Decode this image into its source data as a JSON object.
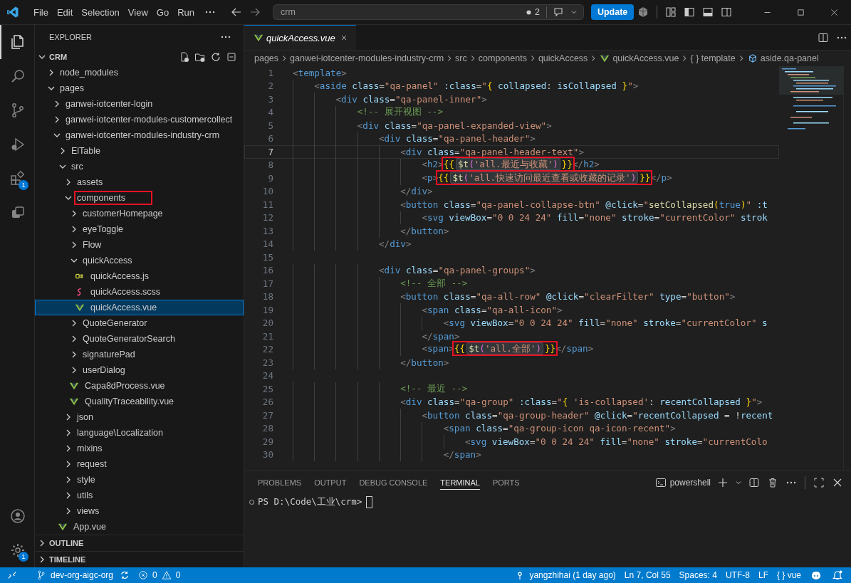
{
  "title_bar": {
    "menu": [
      "File",
      "Edit",
      "Selection",
      "View",
      "Go",
      "Run"
    ],
    "command_center": {
      "label": "crm"
    },
    "changes": {
      "count": "2"
    },
    "update_button": "Update"
  },
  "activity_bar": {
    "items": [
      {
        "kind": "explorer",
        "selected": true
      },
      {
        "kind": "search",
        "selected": false
      },
      {
        "kind": "source-control",
        "selected": false
      },
      {
        "kind": "run-debug",
        "selected": false
      },
      {
        "kind": "extensions",
        "selected": false,
        "badge": "1"
      },
      {
        "kind": "remote",
        "selected": false
      }
    ],
    "bottom": [
      {
        "kind": "accounts"
      },
      {
        "kind": "settings",
        "badge": "1"
      }
    ]
  },
  "sidebar": {
    "title": "EXPLORER",
    "section": {
      "label": "CRM",
      "expanded": true
    },
    "tree": [
      {
        "label": "node_modules",
        "kind": "folder",
        "expanded": false,
        "selected": false,
        "boxed": false
      },
      {
        "label": "pages",
        "kind": "folder",
        "expanded": true,
        "selected": false,
        "boxed": false,
        "children": [
          {
            "label": "ganwei-iotcenter-login",
            "kind": "folder",
            "expanded": false,
            "selected": false,
            "boxed": false
          },
          {
            "label": "ganwei-iotcenter-modules-customercollect",
            "kind": "folder",
            "expanded": false,
            "selected": false,
            "boxed": false
          },
          {
            "label": "ganwei-iotcenter-modules-industry-crm",
            "kind": "folder",
            "expanded": true,
            "selected": false,
            "boxed": false,
            "children": [
              {
                "label": "ElTable",
                "kind": "folder",
                "expanded": false,
                "selected": false,
                "boxed": false
              },
              {
                "label": "src",
                "kind": "folder",
                "expanded": true,
                "selected": false,
                "boxed": false,
                "children": [
                  {
                    "label": "assets",
                    "kind": "folder",
                    "expanded": false,
                    "selected": false,
                    "boxed": false
                  },
                  {
                    "label": "components",
                    "kind": "folder",
                    "expanded": true,
                    "selected": false,
                    "boxed": true,
                    "children": [
                      {
                        "label": "customerHomepage",
                        "kind": "folder",
                        "expanded": false,
                        "selected": false,
                        "boxed": false
                      },
                      {
                        "label": "eyeToggle",
                        "kind": "folder",
                        "expanded": false,
                        "selected": false,
                        "boxed": false
                      },
                      {
                        "label": "Flow",
                        "kind": "folder",
                        "expanded": false,
                        "selected": false,
                        "boxed": false
                      },
                      {
                        "label": "quickAccess",
                        "kind": "folder",
                        "expanded": true,
                        "selected": false,
                        "boxed": false,
                        "children": [
                          {
                            "label": "quickAccess.js",
                            "kind": "js",
                            "selected": false,
                            "boxed": false
                          },
                          {
                            "label": "quickAccess.scss",
                            "kind": "scss",
                            "selected": false,
                            "boxed": false
                          },
                          {
                            "label": "quickAccess.vue",
                            "kind": "vue",
                            "selected": true,
                            "boxed": false
                          }
                        ]
                      },
                      {
                        "label": "QuoteGenerator",
                        "kind": "folder",
                        "expanded": false,
                        "selected": false,
                        "boxed": false
                      },
                      {
                        "label": "QuoteGeneratorSearch",
                        "kind": "folder",
                        "expanded": false,
                        "selected": false,
                        "boxed": false
                      },
                      {
                        "label": "signaturePad",
                        "kind": "folder",
                        "expanded": false,
                        "selected": false,
                        "boxed": false
                      },
                      {
                        "label": "userDialog",
                        "kind": "folder",
                        "expanded": false,
                        "selected": false,
                        "boxed": false
                      },
                      {
                        "label": "Capa8dProcess.vue",
                        "kind": "vue",
                        "selected": false,
                        "boxed": false
                      },
                      {
                        "label": "QualityTraceability.vue",
                        "kind": "vue",
                        "selected": false,
                        "boxed": false
                      }
                    ]
                  },
                  {
                    "label": "json",
                    "kind": "folder",
                    "expanded": false,
                    "selected": false,
                    "boxed": false
                  },
                  {
                    "label": "language\\Localization",
                    "kind": "folder",
                    "expanded": false,
                    "selected": false,
                    "boxed": false
                  },
                  {
                    "label": "mixins",
                    "kind": "folder",
                    "expanded": false,
                    "selected": false,
                    "boxed": false
                  },
                  {
                    "label": "request",
                    "kind": "folder",
                    "expanded": false,
                    "selected": false,
                    "boxed": false
                  },
                  {
                    "label": "style",
                    "kind": "folder",
                    "expanded": false,
                    "selected": false,
                    "boxed": false
                  },
                  {
                    "label": "utils",
                    "kind": "folder",
                    "expanded": false,
                    "selected": false,
                    "boxed": false
                  },
                  {
                    "label": "views",
                    "kind": "folder",
                    "expanded": false,
                    "selected": false,
                    "boxed": false
                  }
                ]
              },
              {
                "label": "App.vue",
                "kind": "vue",
                "selected": false,
                "boxed": false
              }
            ]
          }
        ]
      }
    ],
    "collapsed_sections": [
      {
        "label": "OUTLINE",
        "expanded": false
      },
      {
        "label": "TIMELINE",
        "expanded": false
      }
    ]
  },
  "editor": {
    "tabs": [
      {
        "label": "quickAccess.vue",
        "preview": true,
        "selected": true
      }
    ],
    "breadcrumbs": [
      {
        "kind": "folder",
        "label": "pages"
      },
      {
        "kind": "folder",
        "label": "ganwei-iotcenter-modules-industry-crm"
      },
      {
        "kind": "folder",
        "label": "src"
      },
      {
        "kind": "folder",
        "label": "components"
      },
      {
        "kind": "folder",
        "label": "quickAccess"
      },
      {
        "kind": "vue",
        "label": "quickAccess.vue"
      },
      {
        "kind": "symbol",
        "label": "{ } template"
      },
      {
        "kind": "element",
        "label": "aside.qa-panel"
      }
    ],
    "lines": [
      {
        "n": "1",
        "current": false,
        "tokens": [
          {
            "kind": "tag",
            "text": "<template>"
          }
        ]
      },
      {
        "n": "2",
        "current": false,
        "tokens": [
          {
            "kind": "tag",
            "text": "    <aside"
          },
          {
            "kind": "attr",
            "text": " class"
          },
          {
            "kind": "plain",
            "text": "="
          },
          {
            "kind": "string",
            "text": "\"qa-panel\""
          },
          {
            "kind": "attr",
            "text": " :class"
          },
          {
            "kind": "plain",
            "text": "="
          },
          {
            "kind": "string",
            "text": "\""
          },
          {
            "kind": "brace",
            "text": "{"
          },
          {
            "kind": "var",
            "text": " collapsed"
          },
          {
            "kind": "plain",
            "text": ": "
          },
          {
            "kind": "var",
            "text": "isCollapsed "
          },
          {
            "kind": "brace",
            "text": "}"
          },
          {
            "kind": "string",
            "text": "\""
          },
          {
            "kind": "tag",
            "text": ">"
          }
        ]
      },
      {
        "n": "3",
        "current": false,
        "tokens": [
          {
            "kind": "tag",
            "text": "        <div"
          },
          {
            "kind": "attr",
            "text": " class"
          },
          {
            "kind": "plain",
            "text": "="
          },
          {
            "kind": "string",
            "text": "\"qa-panel-inner\""
          },
          {
            "kind": "tag",
            "text": ">"
          }
        ]
      },
      {
        "n": "4",
        "current": false,
        "tokens": [
          {
            "kind": "comment",
            "text": "            <!-- 展开视图 -->"
          }
        ]
      },
      {
        "n": "5",
        "current": false,
        "tokens": [
          {
            "kind": "tag",
            "text": "            <div"
          },
          {
            "kind": "attr",
            "text": " class"
          },
          {
            "kind": "plain",
            "text": "="
          },
          {
            "kind": "string",
            "text": "\"qa-panel-expanded-view\""
          },
          {
            "kind": "tag",
            "text": ">"
          }
        ]
      },
      {
        "n": "6",
        "current": false,
        "tokens": [
          {
            "kind": "tag",
            "text": "                <div"
          },
          {
            "kind": "attr",
            "text": " class"
          },
          {
            "kind": "plain",
            "text": "="
          },
          {
            "kind": "string",
            "text": "\"qa-panel-header\""
          },
          {
            "kind": "tag",
            "text": ">"
          }
        ]
      },
      {
        "n": "7",
        "current": true,
        "tokens": [
          {
            "kind": "tag",
            "text": "                    <div"
          },
          {
            "kind": "attr",
            "text": " class"
          },
          {
            "kind": "plain",
            "text": "="
          },
          {
            "kind": "string",
            "text": "\"qa-panel-header-text\""
          },
          {
            "kind": "tag",
            "text": ">"
          }
        ]
      },
      {
        "n": "8",
        "current": false,
        "tokens": [
          {
            "kind": "tag",
            "text": "                        <h2>"
          },
          {
            "kind": "annotation",
            "parts": [
              {
                "kind": "brace",
                "text": "{{"
              },
              {
                "kind": "hint",
                "parts": [
                  {
                    "kind": "func",
                    "text": "$t"
                  },
                  {
                    "kind": "paren",
                    "text": "("
                  },
                  {
                    "kind": "string",
                    "text": "'all.最近与收藏'"
                  },
                  {
                    "kind": "paren",
                    "text": ")"
                  }
                ]
              },
              {
                "kind": "brace",
                "text": "}}"
              }
            ]
          },
          {
            "kind": "tag",
            "text": "</h2>"
          }
        ]
      },
      {
        "n": "9",
        "current": false,
        "tokens": [
          {
            "kind": "tag",
            "text": "                        <p>"
          },
          {
            "kind": "annotation",
            "parts": [
              {
                "kind": "brace",
                "text": "{{"
              },
              {
                "kind": "hint",
                "parts": [
                  {
                    "kind": "func",
                    "text": "$t"
                  },
                  {
                    "kind": "paren",
                    "text": "("
                  },
                  {
                    "kind": "string",
                    "text": "'all.快速访问最近查看或收藏的记录'"
                  },
                  {
                    "kind": "paren",
                    "text": ")"
                  }
                ]
              },
              {
                "kind": "brace",
                "text": "}}"
              }
            ]
          },
          {
            "kind": "tag",
            "text": "</p>"
          }
        ]
      },
      {
        "n": "10",
        "current": false,
        "tokens": [
          {
            "kind": "tag",
            "text": "                    </div>"
          }
        ]
      },
      {
        "n": "11",
        "current": false,
        "tokens": [
          {
            "kind": "tag",
            "text": "                    <button"
          },
          {
            "kind": "attr",
            "text": " class"
          },
          {
            "kind": "plain",
            "text": "="
          },
          {
            "kind": "string",
            "text": "\"qa-panel-collapse-btn\""
          },
          {
            "kind": "attr",
            "text": " @click"
          },
          {
            "kind": "plain",
            "text": "="
          },
          {
            "kind": "string",
            "text": "\""
          },
          {
            "kind": "func",
            "text": "setCollapsed"
          },
          {
            "kind": "brace",
            "text": "("
          },
          {
            "kind": "keyword",
            "text": "true"
          },
          {
            "kind": "brace",
            "text": ")"
          },
          {
            "kind": "string",
            "text": "\""
          },
          {
            "kind": "attr",
            "text": " :t"
          }
        ]
      },
      {
        "n": "12",
        "current": false,
        "tokens": [
          {
            "kind": "tag",
            "text": "                        <svg"
          },
          {
            "kind": "attr",
            "text": " viewBox"
          },
          {
            "kind": "plain",
            "text": "="
          },
          {
            "kind": "string",
            "text": "\"0 0 24 24\""
          },
          {
            "kind": "attr",
            "text": " fill"
          },
          {
            "kind": "plain",
            "text": "="
          },
          {
            "kind": "string",
            "text": "\"none\""
          },
          {
            "kind": "attr",
            "text": " stroke"
          },
          {
            "kind": "plain",
            "text": "="
          },
          {
            "kind": "string",
            "text": "\"currentColor\""
          },
          {
            "kind": "attr",
            "text": " strok"
          }
        ]
      },
      {
        "n": "13",
        "current": false,
        "tokens": [
          {
            "kind": "tag",
            "text": "                    </button>"
          }
        ]
      },
      {
        "n": "14",
        "current": false,
        "tokens": [
          {
            "kind": "tag",
            "text": "                </div>"
          }
        ]
      },
      {
        "n": "15",
        "current": false
      },
      {
        "n": "16",
        "current": false,
        "tokens": [
          {
            "kind": "tag",
            "text": "                <div"
          },
          {
            "kind": "attr",
            "text": " class"
          },
          {
            "kind": "plain",
            "text": "="
          },
          {
            "kind": "string",
            "text": "\"qa-panel-groups\""
          },
          {
            "kind": "tag",
            "text": ">"
          }
        ]
      },
      {
        "n": "17",
        "current": false,
        "tokens": [
          {
            "kind": "comment",
            "text": "                    <!-- 全部 -->"
          }
        ]
      },
      {
        "n": "18",
        "current": false,
        "tokens": [
          {
            "kind": "tag",
            "text": "                    <button"
          },
          {
            "kind": "attr",
            "text": " class"
          },
          {
            "kind": "plain",
            "text": "="
          },
          {
            "kind": "string",
            "text": "\"qa-all-row\""
          },
          {
            "kind": "attr",
            "text": " @click"
          },
          {
            "kind": "plain",
            "text": "="
          },
          {
            "kind": "string",
            "text": "\"clearFilter\""
          },
          {
            "kind": "attr",
            "text": " type"
          },
          {
            "kind": "plain",
            "text": "="
          },
          {
            "kind": "string",
            "text": "\"button\""
          },
          {
            "kind": "tag",
            "text": ">"
          }
        ]
      },
      {
        "n": "19",
        "current": false,
        "tokens": [
          {
            "kind": "tag",
            "text": "                        <span"
          },
          {
            "kind": "attr",
            "text": " class"
          },
          {
            "kind": "plain",
            "text": "="
          },
          {
            "kind": "string",
            "text": "\"qa-all-icon\""
          },
          {
            "kind": "tag",
            "text": ">"
          }
        ]
      },
      {
        "n": "20",
        "current": false,
        "tokens": [
          {
            "kind": "tag",
            "text": "                            <svg"
          },
          {
            "kind": "attr",
            "text": " viewBox"
          },
          {
            "kind": "plain",
            "text": "="
          },
          {
            "kind": "string",
            "text": "\"0 0 24 24\""
          },
          {
            "kind": "attr",
            "text": " fill"
          },
          {
            "kind": "plain",
            "text": "="
          },
          {
            "kind": "string",
            "text": "\"none\""
          },
          {
            "kind": "attr",
            "text": " stroke"
          },
          {
            "kind": "plain",
            "text": "="
          },
          {
            "kind": "string",
            "text": "\"currentColor\""
          },
          {
            "kind": "attr",
            "text": " s"
          }
        ]
      },
      {
        "n": "21",
        "current": false,
        "tokens": [
          {
            "kind": "tag",
            "text": "                        </span>"
          }
        ]
      },
      {
        "n": "22",
        "current": false,
        "tokens": [
          {
            "kind": "tag",
            "text": "                        <span>"
          },
          {
            "kind": "annotation",
            "parts": [
              {
                "kind": "brace",
                "text": "{{"
              },
              {
                "kind": "hint",
                "parts": [
                  {
                    "kind": "func",
                    "text": "$t"
                  },
                  {
                    "kind": "paren",
                    "text": "("
                  },
                  {
                    "kind": "string",
                    "text": "'all.全部'"
                  },
                  {
                    "kind": "paren",
                    "text": ")"
                  }
                ]
              },
              {
                "kind": "brace",
                "text": "}}"
              }
            ]
          },
          {
            "kind": "tag",
            "text": "</span>"
          }
        ]
      },
      {
        "n": "23",
        "current": false,
        "tokens": [
          {
            "kind": "tag",
            "text": "                    </button>"
          }
        ]
      },
      {
        "n": "24",
        "current": false
      },
      {
        "n": "25",
        "current": false,
        "tokens": [
          {
            "kind": "comment",
            "text": "                    <!-- 最近 -->"
          }
        ]
      },
      {
        "n": "26",
        "current": false,
        "tokens": [
          {
            "kind": "tag",
            "text": "                    <div"
          },
          {
            "kind": "attr",
            "text": " class"
          },
          {
            "kind": "plain",
            "text": "="
          },
          {
            "kind": "string",
            "text": "\"qa-group\""
          },
          {
            "kind": "attr",
            "text": " :class"
          },
          {
            "kind": "plain",
            "text": "="
          },
          {
            "kind": "string",
            "text": "\""
          },
          {
            "kind": "brace",
            "text": "{"
          },
          {
            "kind": "string",
            "text": " 'is-collapsed'"
          },
          {
            "kind": "plain",
            "text": ": "
          },
          {
            "kind": "var",
            "text": "recentCollapsed "
          },
          {
            "kind": "brace",
            "text": "}"
          },
          {
            "kind": "string",
            "text": "\""
          },
          {
            "kind": "tag",
            "text": ">"
          }
        ]
      },
      {
        "n": "27",
        "current": false,
        "tokens": [
          {
            "kind": "tag",
            "text": "                        <button"
          },
          {
            "kind": "attr",
            "text": " class"
          },
          {
            "kind": "plain",
            "text": "="
          },
          {
            "kind": "string",
            "text": "\"qa-group-header\""
          },
          {
            "kind": "attr",
            "text": " @click"
          },
          {
            "kind": "plain",
            "text": "="
          },
          {
            "kind": "string",
            "text": "\""
          },
          {
            "kind": "var",
            "text": "recentCollapsed"
          },
          {
            "kind": "plain",
            "text": " = !"
          },
          {
            "kind": "var",
            "text": "recent"
          }
        ]
      },
      {
        "n": "28",
        "current": false,
        "tokens": [
          {
            "kind": "tag",
            "text": "                            <span"
          },
          {
            "kind": "attr",
            "text": " class"
          },
          {
            "kind": "plain",
            "text": "="
          },
          {
            "kind": "string",
            "text": "\"qa-group-icon qa-icon-recent\""
          },
          {
            "kind": "tag",
            "text": ">"
          }
        ]
      },
      {
        "n": "29",
        "current": false,
        "tokens": [
          {
            "kind": "tag",
            "text": "                                <svg"
          },
          {
            "kind": "attr",
            "text": " viewBox"
          },
          {
            "kind": "plain",
            "text": "="
          },
          {
            "kind": "string",
            "text": "\"0 0 24 24\""
          },
          {
            "kind": "attr",
            "text": " fill"
          },
          {
            "kind": "plain",
            "text": "="
          },
          {
            "kind": "string",
            "text": "\"none\""
          },
          {
            "kind": "attr",
            "text": " stroke"
          },
          {
            "kind": "plain",
            "text": "="
          },
          {
            "kind": "string",
            "text": "\"currentColo"
          }
        ]
      },
      {
        "n": "30",
        "current": false,
        "tokens": [
          {
            "kind": "tag",
            "text": "                            </span>"
          }
        ]
      }
    ]
  },
  "panel": {
    "tabs": [
      {
        "label": "PROBLEMS",
        "selected": false
      },
      {
        "label": "OUTPUT",
        "selected": false
      },
      {
        "label": "DEBUG CONSOLE",
        "selected": false
      },
      {
        "label": "TERMINAL",
        "selected": true
      },
      {
        "label": "PORTS",
        "selected": false
      }
    ],
    "terminal_name": "powershell",
    "prompt": "PS D:\\Code\\工业\\crm>"
  },
  "status_bar": {
    "branch": "dev-org-aigc-org",
    "errors": "0",
    "warnings": "0",
    "right": [
      {
        "kind": "blame",
        "text": "yangzhihai (1 day ago)"
      },
      {
        "kind": "text",
        "text": "Ln 7, Col 55"
      },
      {
        "kind": "text",
        "text": "Spaces: 4"
      },
      {
        "kind": "text",
        "text": "UTF-8"
      },
      {
        "kind": "text",
        "text": "LF"
      },
      {
        "kind": "text",
        "text": "{ } vue"
      },
      {
        "kind": "copilot"
      },
      {
        "kind": "bell"
      }
    ]
  }
}
